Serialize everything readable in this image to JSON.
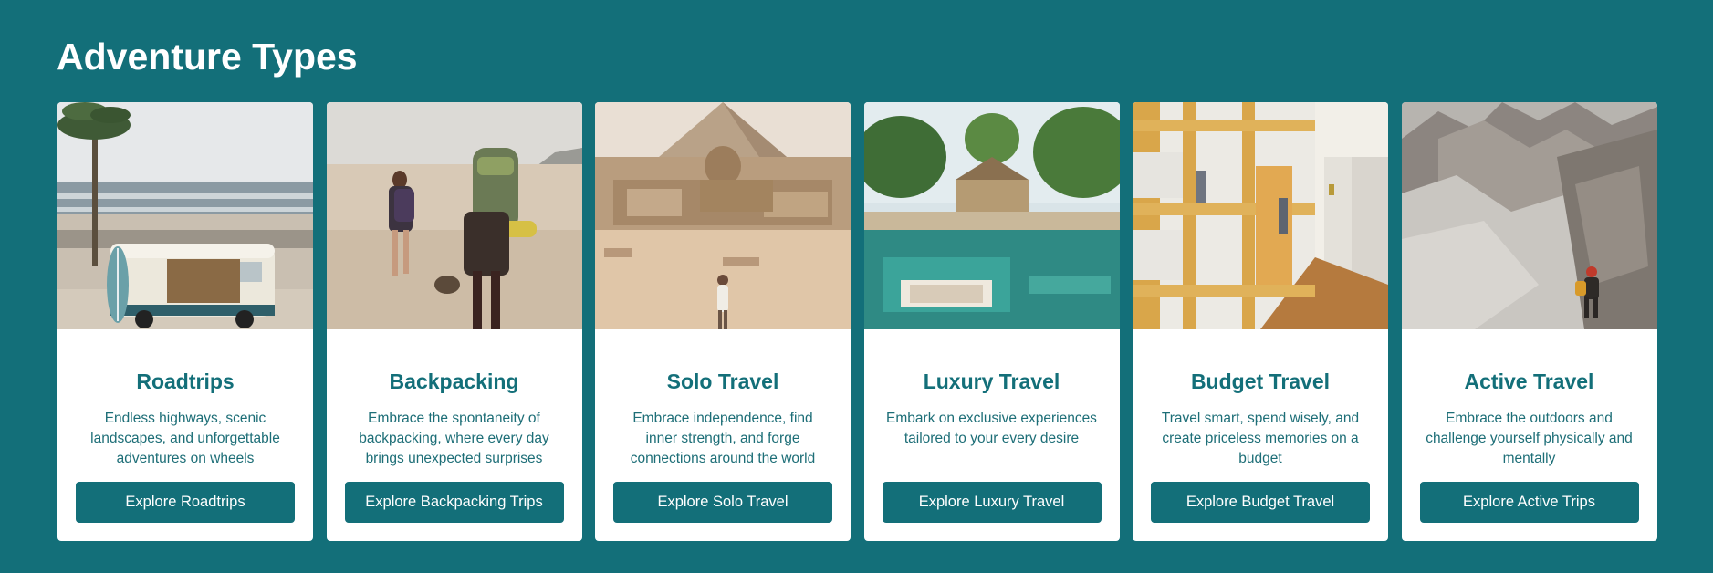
{
  "section": {
    "title": "Adventure Types"
  },
  "cards": [
    {
      "title": "Roadtrips",
      "description": "Endless highways, scenic landscapes, and unforgettable adventures on wheels",
      "button": "Explore Roadtrips",
      "image": "camper-van-on-beach"
    },
    {
      "title": "Backpacking",
      "description": "Embrace the spontaneity of backpacking, where every day brings unexpected surprises",
      "button": "Explore Backpacking Trips",
      "image": "backpackers-walking-on-beach"
    },
    {
      "title": "Solo Travel",
      "description": "Embrace independence, find inner strength, and forge connections around the world",
      "button": "Explore Solo Travel",
      "image": "sphinx-and-pyramid"
    },
    {
      "title": "Luxury Travel",
      "description": "Embark on exclusive experiences tailored to your every desire",
      "button": "Explore Luxury Travel",
      "image": "tropical-resort-pool"
    },
    {
      "title": "Budget Travel",
      "description": "Travel smart, spend wisely, and create priceless memories on a budget",
      "button": "Explore Budget Travel",
      "image": "hostel-bunk-beds"
    },
    {
      "title": "Active Travel",
      "description": "Embrace the outdoors and challenge yourself physically and mentally",
      "button": "Explore Active Trips",
      "image": "mountain-climber"
    }
  ],
  "colors": {
    "background": "#136f79",
    "card": "#ffffff",
    "accent": "#136f79"
  }
}
